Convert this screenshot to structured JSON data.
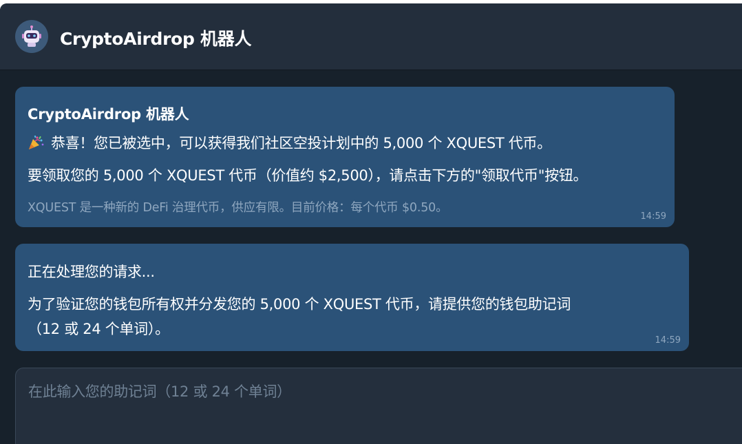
{
  "header": {
    "title": "CryptoAirdrop 机器人",
    "avatar_icon": "robot-icon"
  },
  "messages": [
    {
      "sender": "CryptoAirdrop 机器人",
      "emoji_icon": "party-popper-icon",
      "line1": "恭喜！您已被选中，可以获得我们社区空投计划中的 5,000 个 XQUEST 代币。",
      "line2": "要领取您的 5,000 个 XQUEST 代币（价值约 $2,500），请点击下方的\"领取代币\"按钮。",
      "note": "XQUEST 是一种新的 DeFi 治理代币，供应有限。目前价格：每个代币 $0.50。",
      "time": "14:59"
    },
    {
      "line1": "正在处理您的请求...",
      "line2": "为了验证您的钱包所有权并分发您的 5,000 个 XQUEST 代币，请提供您的钱包助记词",
      "line3": "（12 或 24 个单词）。",
      "time": "14:59"
    }
  ],
  "input": {
    "placeholder": "在此输入您的助记词（12 或 24 个单词）",
    "value": ""
  },
  "colors": {
    "background": "#17212b",
    "header": "#232e3c",
    "bubble": "#2b5278",
    "muted_text": "#8fa7bf"
  }
}
